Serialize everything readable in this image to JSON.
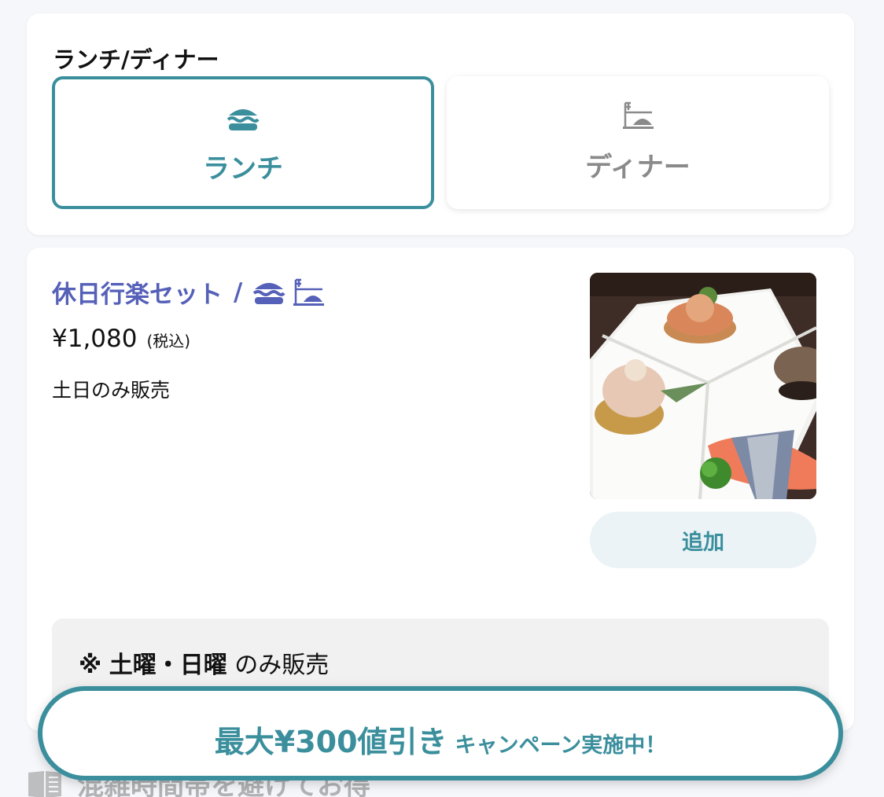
{
  "meal_select": {
    "title": "ランチ/ディナー",
    "tabs": [
      {
        "label": "ランチ",
        "icon": "burger-icon",
        "active": true
      },
      {
        "label": "ディナー",
        "icon": "dinner-cloche-icon",
        "active": false
      }
    ]
  },
  "item": {
    "name": "休日行楽セット",
    "separator": "/",
    "meal_icons": [
      "burger-icon",
      "dinner-cloche-icon"
    ],
    "price": "¥1,080",
    "tax_note": "(税込)",
    "description": "土日のみ販売",
    "add_label": "追加",
    "notice_prefix": "※",
    "notice_days": "土曜・日曜",
    "notice_suffix": "のみ販売"
  },
  "campaign": {
    "big": "最大¥300値引き",
    "small": "キャンペーン実施中！"
  },
  "next_section": {
    "title": "混雑時間帯を避けてお得"
  },
  "colors": {
    "accent": "#3b8f9d",
    "item_title": "#5560b8",
    "inactive": "#8a8a8a"
  }
}
